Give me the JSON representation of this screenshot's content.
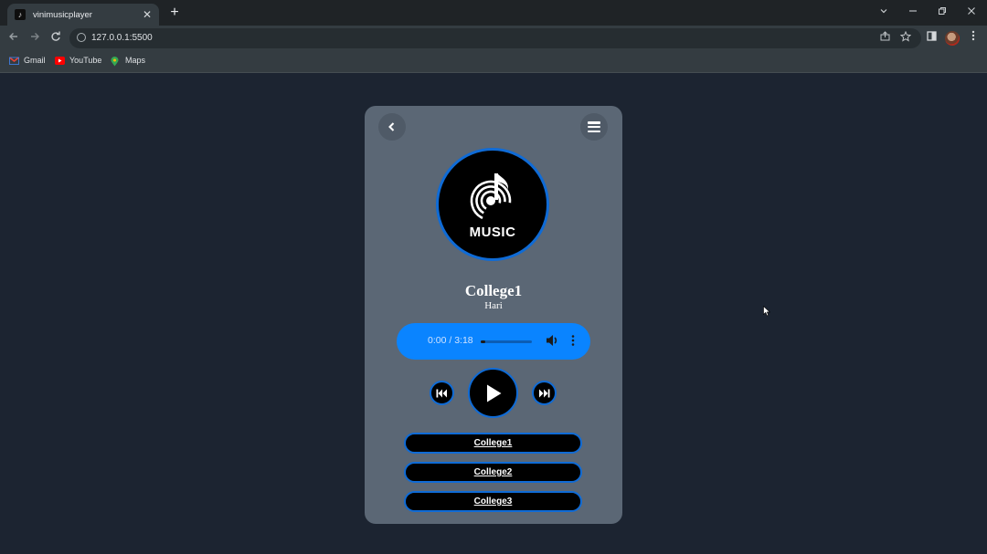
{
  "browser": {
    "tab_title": "vinimusicplayer",
    "tab_close": "✕",
    "new_tab": "+",
    "url": "127.0.0.1:5500",
    "bookmarks": [
      {
        "label": "Gmail",
        "icon": "gmail-icon",
        "color": "#ea4335"
      },
      {
        "label": "YouTube",
        "icon": "youtube-icon",
        "color": "#ff0000"
      },
      {
        "label": "Maps",
        "icon": "maps-icon",
        "color": "#34a853"
      }
    ]
  },
  "player": {
    "cover_text": "MUSIC",
    "song_title": "College1",
    "artist": "Hari",
    "audio": {
      "time": "0:00 / 3:18",
      "progress": 0.0
    },
    "playlist": [
      "College1",
      "College2",
      "College3"
    ]
  },
  "colors": {
    "background": "#1c2431",
    "card": "#5b6775",
    "accent": "#0a84ff",
    "border_accent": "#0f6bd6"
  }
}
